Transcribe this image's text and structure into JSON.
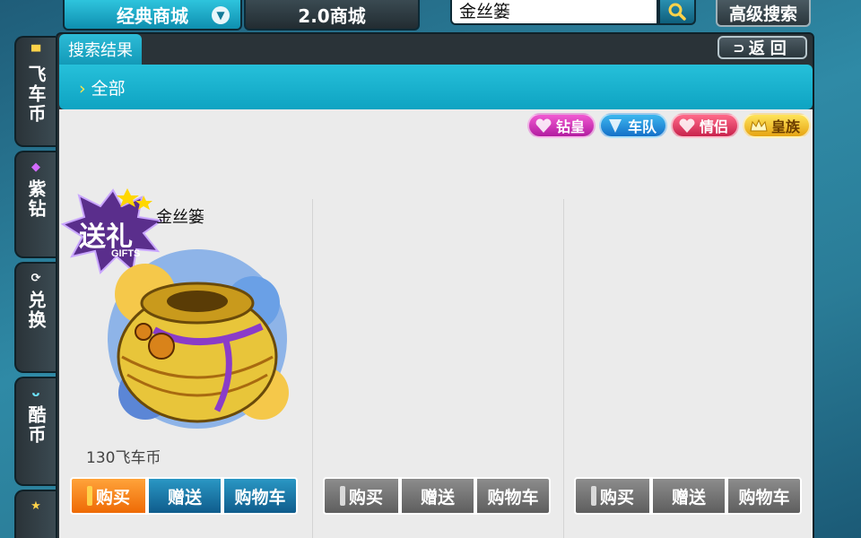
{
  "top_nav": {
    "classic_store": "经典商城",
    "store_v2": "2.0商城",
    "search_value": "金丝篓",
    "advanced_search": "高级搜索"
  },
  "sidebar": {
    "items": [
      {
        "label": "飞车币",
        "icon": "tshirt-icon"
      },
      {
        "label": "紫钻",
        "icon": "gem-icon"
      },
      {
        "label": "兑换",
        "icon": "refresh-icon"
      },
      {
        "label": "酷币",
        "icon": "mascot-icon"
      },
      {
        "label": "",
        "icon": "star-icon"
      }
    ]
  },
  "panel": {
    "result_tab": "搜索结果",
    "back": "返回",
    "category": "全部"
  },
  "badges": [
    "钻皇",
    "车队",
    "情侣",
    "皇族"
  ],
  "items": [
    {
      "name": "金丝篓",
      "price": "130飞车币",
      "gift_tag": "送礼",
      "gift_tag_sub": "GIFTS",
      "buy": "购买",
      "gift": "赠送",
      "cart": "购物车",
      "state": "active"
    },
    {
      "name": "",
      "price": "",
      "buy": "购买",
      "gift": "赠送",
      "cart": "购物车",
      "state": "disabled"
    },
    {
      "name": "",
      "price": "",
      "buy": "购买",
      "gift": "赠送",
      "cart": "购物车",
      "state": "disabled"
    }
  ],
  "colors": {
    "accent_cyan": "#19b0cd",
    "buy_orange": "#f07a10",
    "button_blue": "#1a73a6",
    "disabled_gray": "#767676"
  }
}
